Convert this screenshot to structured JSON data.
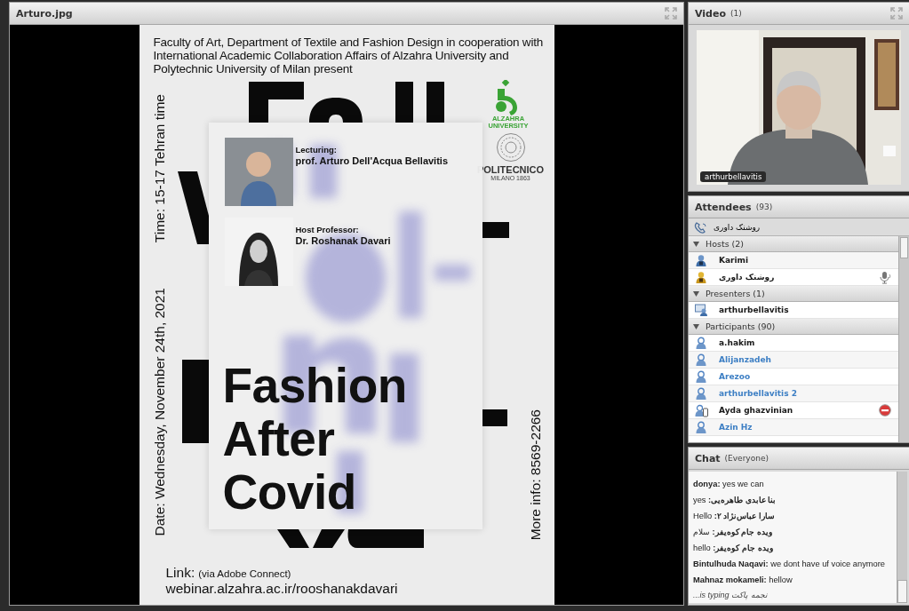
{
  "share_pod": {
    "title": "Arturo.jpg",
    "poster": {
      "intro": "Faculty of Art, Department of Textile and Fashion Design in cooperation with International Academic Collaboration Affairs of Alzahra University and Polytechnic University of Milan present",
      "time": "Time: 15-17 Tehran time",
      "date": "Date: Wednesday, November 24th, 2021",
      "more_info": "More info: 8569-2266",
      "alzahra_logo": [
        "ALZAHRA",
        "UNIVERSITY"
      ],
      "polimi_logo": [
        "POLITECNICO",
        "MILANO 1863"
      ],
      "speakers": [
        {
          "role": "Lecturing:",
          "name": "prof. Arturo Dell'Acqua Bellavitis"
        },
        {
          "role": "Host Professor:",
          "name": "Dr. Roshanak Davari"
        }
      ],
      "headline": [
        "Fashion",
        "After",
        "Covid"
      ],
      "link_label": "Link:",
      "link_note": "(via Adobe Connect)",
      "link_url": "webinar.alzahra.ac.ir/rooshanakdavari"
    }
  },
  "video_pod": {
    "title": "Video",
    "count": "(1)",
    "camera_name": "arthurbellavitis"
  },
  "attendees_pod": {
    "title": "Attendees",
    "count": "(93)",
    "caller": "روشنک داوری",
    "groups": [
      {
        "label": "Hosts (2)",
        "expanded": true,
        "members": [
          {
            "name": "Karimi",
            "kind": "host",
            "color": "#1a1a1a",
            "speaking": false,
            "blocked": false
          },
          {
            "name": "روشنک داوری",
            "kind": "host-speaker",
            "color": "#1a1a1a",
            "speaking": true,
            "blocked": false
          }
        ]
      },
      {
        "label": "Presenters (1)",
        "expanded": true,
        "members": [
          {
            "name": "arthurbellavitis",
            "kind": "presenter",
            "color": "#1a1a1a",
            "speaking": false,
            "blocked": false
          }
        ]
      },
      {
        "label": "Participants (90)",
        "expanded": true,
        "members": [
          {
            "name": "a.hakim",
            "kind": "participant",
            "color": "#1a1a1a",
            "speaking": false,
            "blocked": false
          },
          {
            "name": "Alijanzadeh",
            "kind": "participant",
            "color": "#3d7fc4",
            "speaking": false,
            "blocked": false
          },
          {
            "name": "Arezoo",
            "kind": "participant",
            "color": "#3d7fc4",
            "speaking": false,
            "blocked": false
          },
          {
            "name": "arthurbellavitis 2",
            "kind": "participant",
            "color": "#3d7fc4",
            "speaking": false,
            "blocked": false
          },
          {
            "name": "Ayda ghazvinian",
            "kind": "mobile",
            "color": "#1a1a1a",
            "speaking": false,
            "blocked": true
          },
          {
            "name": "Azin Hz",
            "kind": "participant",
            "color": "#3d7fc4",
            "speaking": false,
            "blocked": false
          }
        ]
      }
    ]
  },
  "chat_pod": {
    "title": "Chat",
    "scope": "(Everyone)",
    "messages": [
      "**donya:** yes we can",
      "**بنا عابدی طاهره‌یی:** yes",
      "**سارا عباس‌نژاد ۲:** Hello",
      "**ویده جام کوه‌یفر:** سلام",
      "**ویده جام کوه‌یفر:** hello",
      "**Bintulhuda Naqavi:** we dont have uf voice anymore",
      "**Mahnaz mokameli:** hellow"
    ],
    "typing": "نجمه پاکت is typing..."
  }
}
